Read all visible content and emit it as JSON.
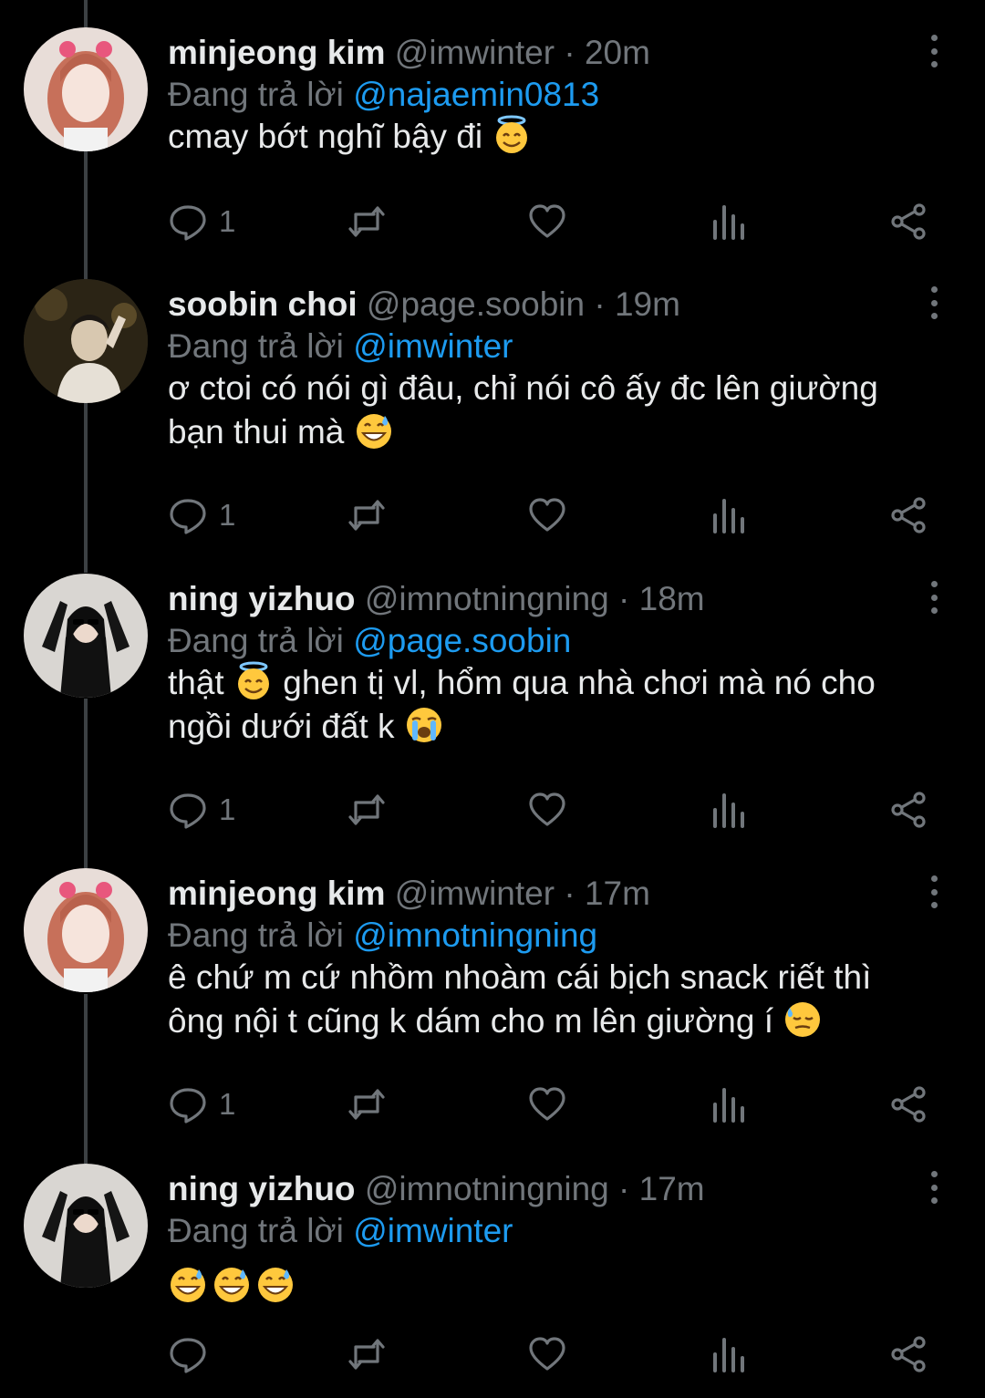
{
  "tweets": [
    {
      "name": "minjeong kim",
      "handle": "@imwinter",
      "dot": "·",
      "time": "20m",
      "reply_prefix": "Đang trả lời",
      "reply_to": "@najaemin0813",
      "text_lines": [
        "cmay bớt nghĩ bậy đi"
      ],
      "replies": "1",
      "avatar": "avatar-minjeong"
    },
    {
      "name": "soobin choi",
      "handle": "@page.soobin",
      "dot": "·",
      "time": "19m",
      "reply_prefix": "Đang trả lời",
      "reply_to": "@imwinter",
      "text_lines": [
        "ơ ctoi có nói gì đâu, chỉ nói cô ấy đc lên giường",
        "bạn thui mà"
      ],
      "replies": "1",
      "avatar": "avatar-soobin"
    },
    {
      "name": "ning yizhuo",
      "handle": "@imnotningning",
      "dot": "·",
      "time": "18m",
      "reply_prefix": "Đang trả lời",
      "reply_to": "@page.soobin",
      "text_part1": "thật",
      "text_part2": "ghen tị vl, hổm qua nhà chơi mà nó cho",
      "text_line2": "ngồi dưới đất k",
      "replies": "1",
      "avatar": "avatar-ningning"
    },
    {
      "name": "minjeong kim",
      "handle": "@imwinter",
      "dot": "·",
      "time": "17m",
      "reply_prefix": "Đang trả lời",
      "reply_to": "@imnotningning",
      "text_lines": [
        "ê chứ m cứ nhồm nhoàm cái bịch snack riết thì",
        "ông nội t cũng k dám cho m lên giường í"
      ],
      "replies": "1",
      "avatar": "avatar-minjeong"
    },
    {
      "name": "ning yizhuo",
      "handle": "@imnotningning",
      "dot": "·",
      "time": "17m",
      "reply_prefix": "Đang trả lời",
      "reply_to": "@imwinter",
      "replies": "",
      "avatar": "avatar-ningning"
    }
  ],
  "icons": {
    "reply": "reply-icon",
    "retweet": "retweet-icon",
    "like": "heart-icon",
    "views": "views-icon",
    "share": "share-icon",
    "more": "more-vertical-icon"
  },
  "colors": {
    "background": "#000000",
    "text": "#e7e9ea",
    "muted": "#71767b",
    "link": "#1d9bf0",
    "thread_line": "#3c4043"
  }
}
